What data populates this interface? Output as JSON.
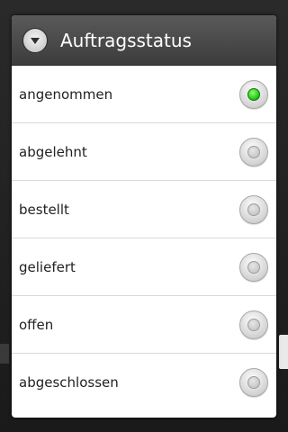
{
  "dialog": {
    "title": "Auftragsstatus",
    "icon": "chevron-down-circle-icon"
  },
  "options": [
    {
      "label": "angenommen",
      "checked": true
    },
    {
      "label": "abgelehnt",
      "checked": false
    },
    {
      "label": "bestellt",
      "checked": false
    },
    {
      "label": "geliefert",
      "checked": false
    },
    {
      "label": "offen",
      "checked": false
    },
    {
      "label": "abgeschlossen",
      "checked": false
    }
  ],
  "colors": {
    "selected_radio": "#1bbf12",
    "header_background": "#4a4a4a"
  }
}
